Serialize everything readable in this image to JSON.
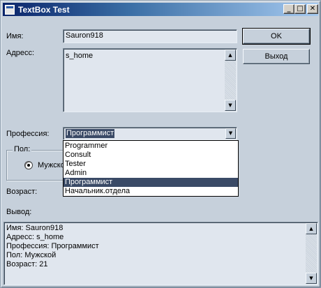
{
  "window": {
    "title": "TextBox Test"
  },
  "caption_buttons": {
    "minimize": "_",
    "maximize": "□",
    "close": "✕"
  },
  "form": {
    "name_label": "Имя:",
    "name_value": "Sauron918",
    "address_label": "Адресс:",
    "address_value": "s_home",
    "profession_label": "Профессия:",
    "profession_selected": "Программист",
    "gender_group_label": "Пол:",
    "gender_radio_label": "Мужско",
    "age_label": "Возраст:",
    "output_label": "Вывод:"
  },
  "buttons": {
    "ok": "OK",
    "exit": "Выход"
  },
  "profession_options": [
    "Programmer",
    "Consult",
    "Tester",
    "Admin",
    "Программист",
    "Начальник.отдела"
  ],
  "selected_option_index": 4,
  "output_lines": [
    "Имя: Sauron918",
    "Адресс: s_home",
    "Профессия: Программист",
    "Пол: Мужской",
    "Возраст: 21"
  ],
  "icons": {
    "scroll_up": "▲",
    "scroll_down": "▼",
    "combo_arrow": "▼"
  },
  "colors": {
    "window_bg": "#c6d0db",
    "selection": "#3a4a66",
    "title_gradient_start": "#0a246a"
  }
}
